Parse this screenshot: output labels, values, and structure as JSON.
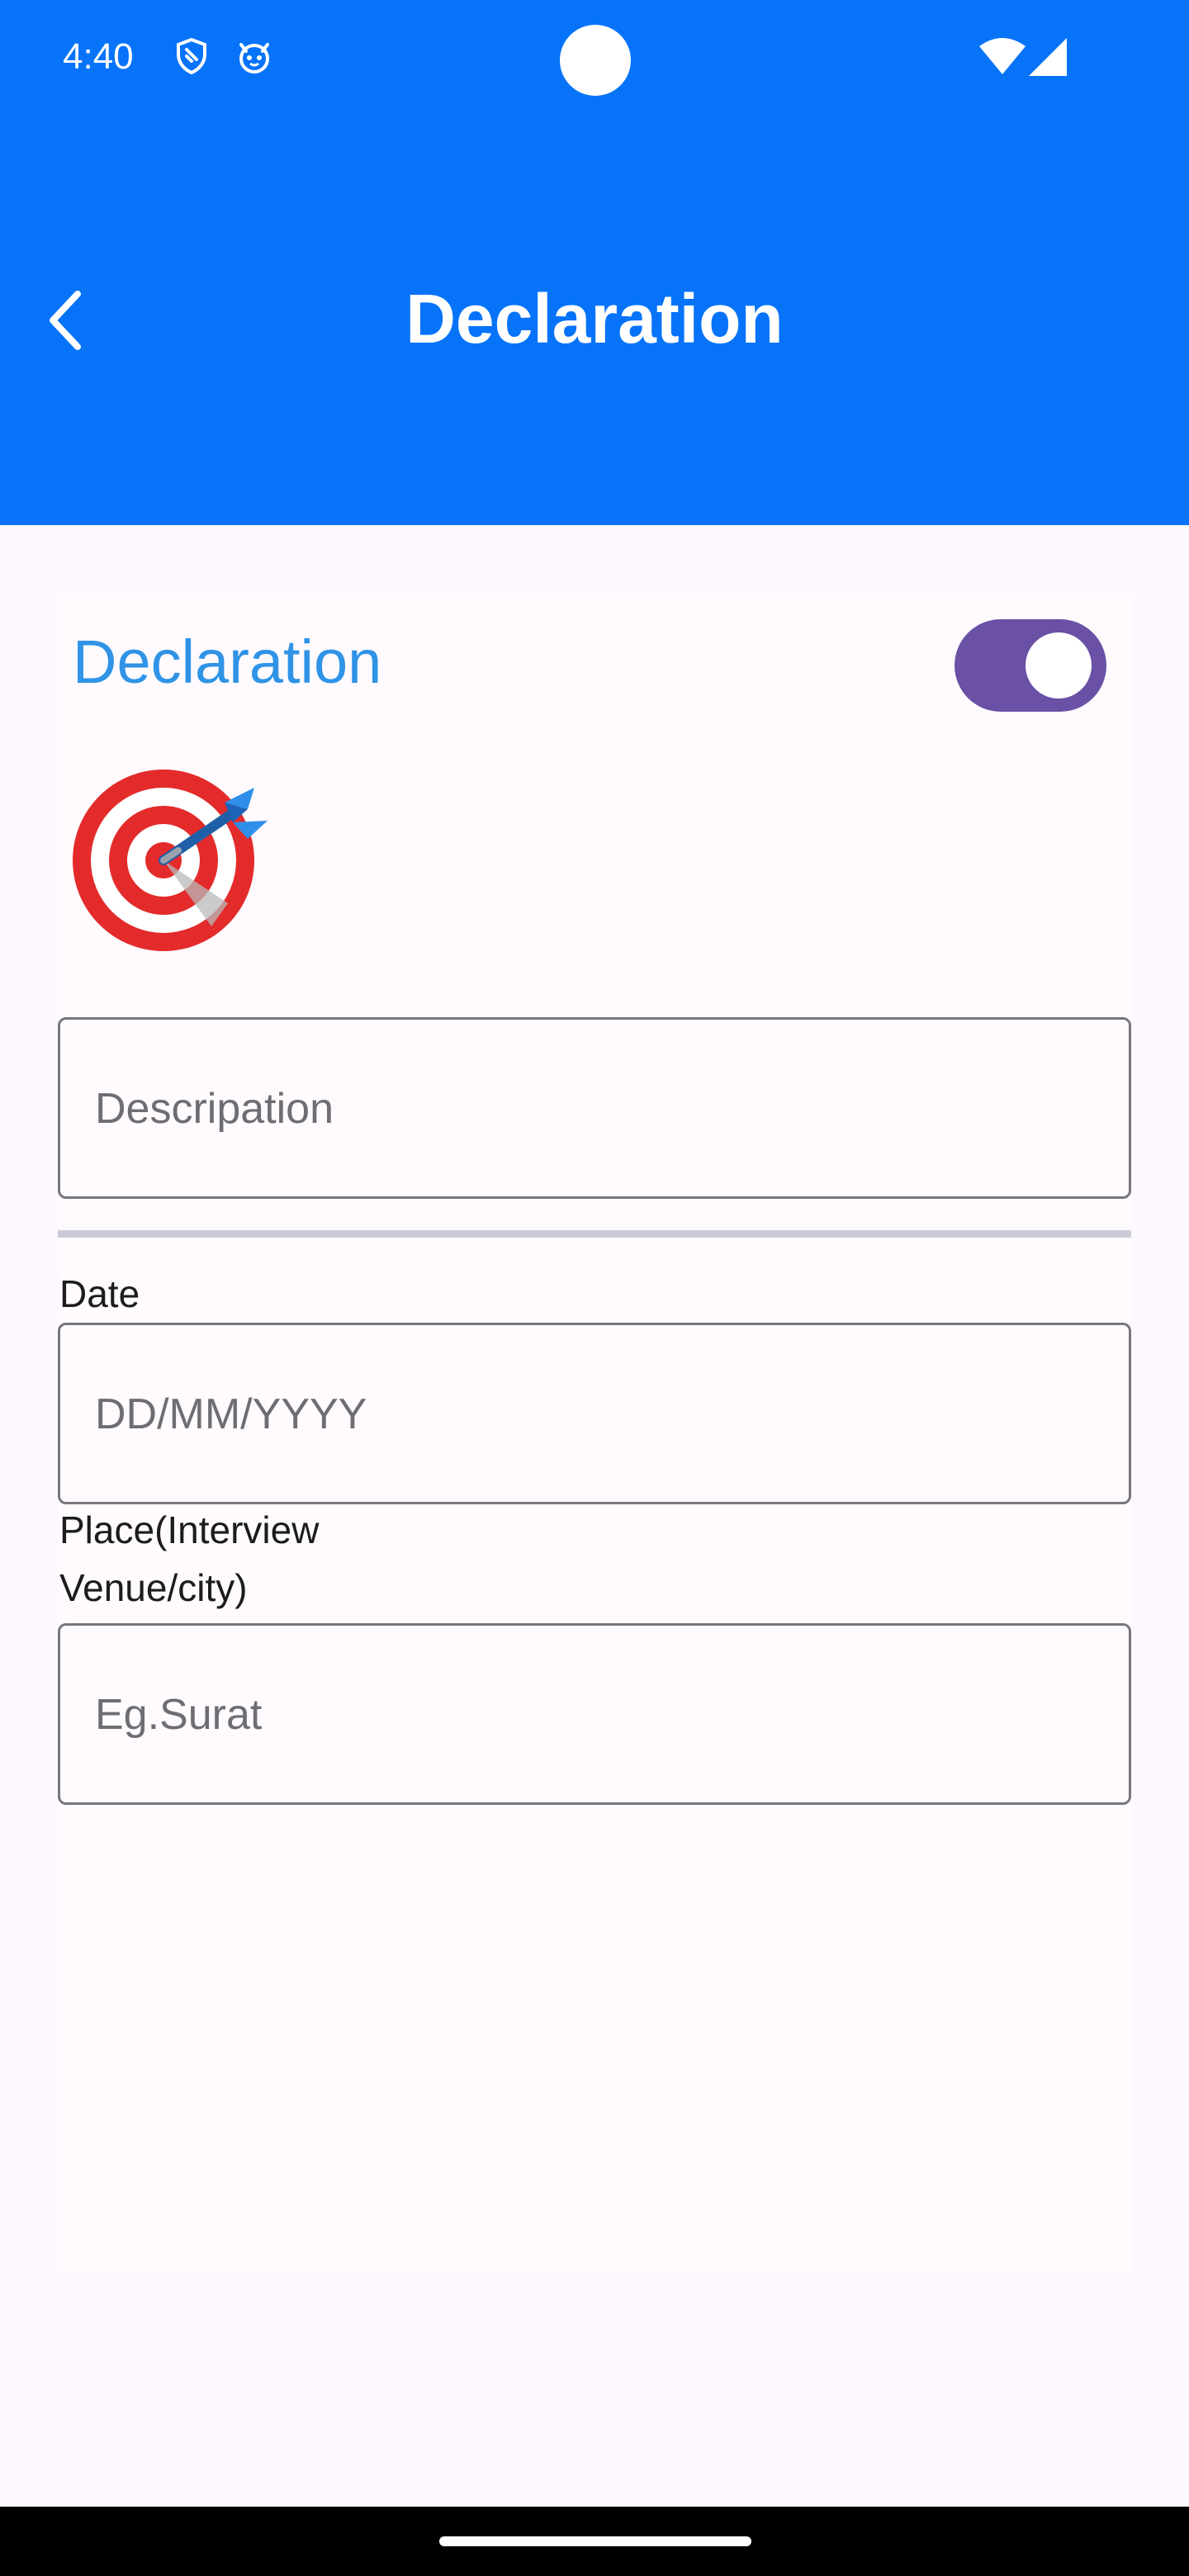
{
  "status_bar": {
    "time": "4:40",
    "icons": [
      "shield-icon",
      "cat-face-icon",
      "wifi-icon",
      "cellular-signal-icon"
    ]
  },
  "header": {
    "title": "Declaration",
    "back_icon": "chevron-left-icon",
    "background": "#0673f9"
  },
  "section": {
    "title": "Declaration",
    "title_color": "#2f93e6",
    "toggle_on": true,
    "toggle_color": "#6a51a6",
    "image_icon": "direct-hit-dart-icon"
  },
  "form": {
    "description_placeholder": "Descripation",
    "date_label": "Date",
    "date_placeholder": "DD/MM/YYYY",
    "place_label_line1": "Place(Interview",
    "place_label_line2": "Venue/city)",
    "place_placeholder": "Eg.Surat"
  }
}
